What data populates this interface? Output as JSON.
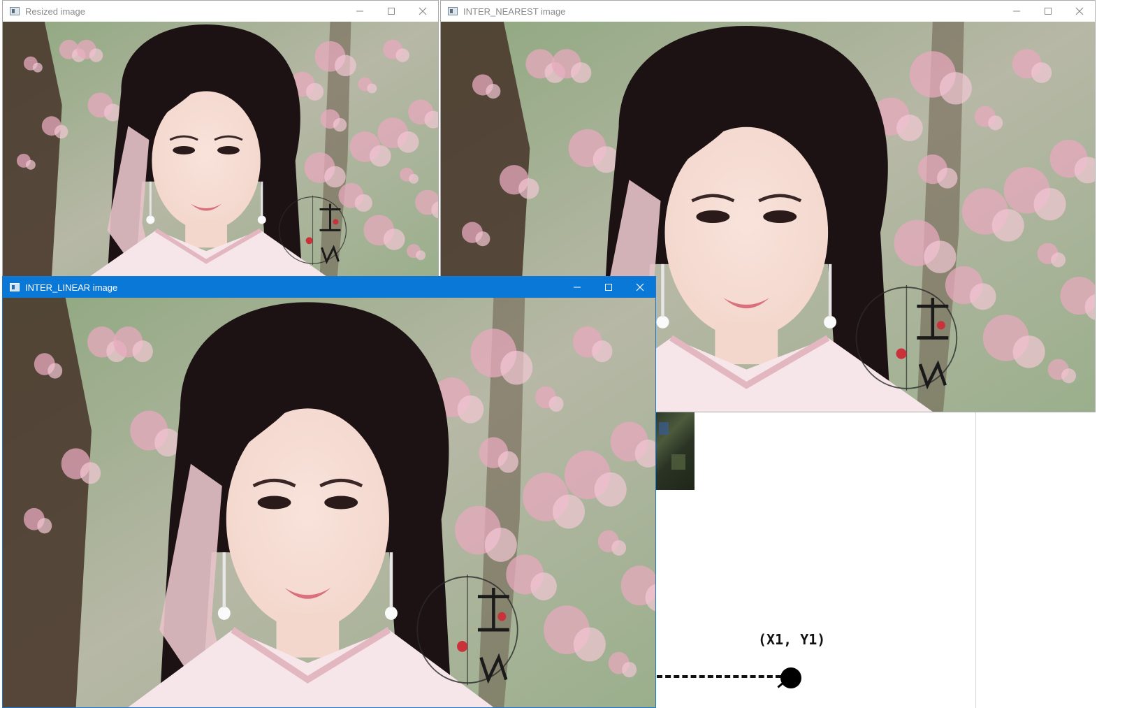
{
  "windows": {
    "resized": {
      "title": "Resized image"
    },
    "nearest": {
      "title": "INTER_NEAREST image"
    },
    "linear": {
      "title": "INTER_LINEAR image"
    }
  },
  "controls": {
    "minimize": "—",
    "maximize": "☐",
    "close": "✕"
  },
  "diagram": {
    "point_label": "(X1, Y1)"
  },
  "colors": {
    "active_titlebar": "#0a78d7",
    "inactive_title_text": "#8a8a8a",
    "hair": "#1c1214",
    "skin": "#f3d6cc",
    "blossom": "#e7a9bd",
    "foliage": "#7e9a6e",
    "trunk": "#4a3a2e"
  }
}
